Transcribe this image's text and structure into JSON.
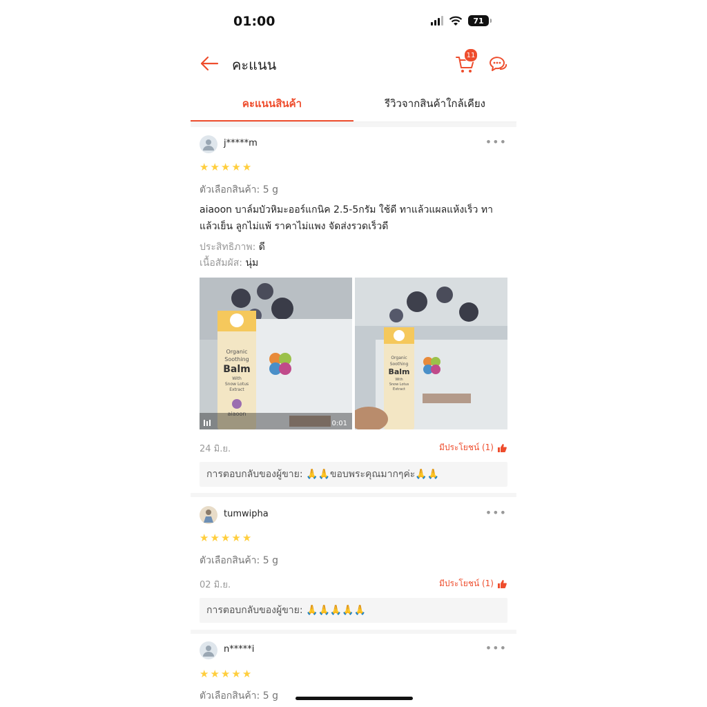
{
  "status_bar": {
    "time": "01:00",
    "battery": "71"
  },
  "header": {
    "title": "คะแนน",
    "cart_count": "11"
  },
  "tabs": [
    {
      "label": "คะแนนสินค้า"
    },
    {
      "label": "รีวิวจากสินค้าใกล้เคียง"
    }
  ],
  "reviews": [
    {
      "user": "j*****m",
      "variant": "ตัวเลือกสินค้า: 5 g",
      "comment": "aiaoon บาล์มบัวหิมะออร์แกนิค 2.5-5กรัม ใช้ดี ทาแล้วแผลแห้งเร็ว ทาแล้วเย็น ลูกไม่แพ้ ราคาไม่แพง จัดส่งรวดเร็วดี",
      "effectiveness_label": "ประสิทธิภาพ:",
      "effectiveness_value": "ดี",
      "texture_label": "เนื้อสัมผัส:",
      "texture_value": "นุ่ม",
      "media": [
        {
          "type": "video",
          "duration": "0:01",
          "text": [
            "Organic",
            "Soothing",
            "Balm",
            "With",
            "Snow Lotus",
            "Extract",
            "aiaoon"
          ]
        },
        {
          "type": "image",
          "text": [
            "Organic",
            "Soothing",
            "Balm",
            "With",
            "Snow Lotus",
            "Extract"
          ]
        }
      ],
      "date": "24 มิ.ย.",
      "helpful": "มีประโยชน์ (1)",
      "seller_reply": "การตอบกลับของผู้ขาย: 🙏🙏ขอบพระคุณมากๆค่ะ🙏🙏"
    },
    {
      "user": "tumwipha",
      "variant": "ตัวเลือกสินค้า: 5 g",
      "date": "02 มิ.ย.",
      "helpful": "มีประโยชน์ (1)",
      "seller_reply": "การตอบกลับของผู้ขาย: 🙏🙏🙏🙏🙏"
    },
    {
      "user": "n*****i",
      "variant": "ตัวเลือกสินค้า: 5 g"
    }
  ],
  "colors": {
    "accent": "#ee4d2d",
    "star": "#ffce3d"
  }
}
